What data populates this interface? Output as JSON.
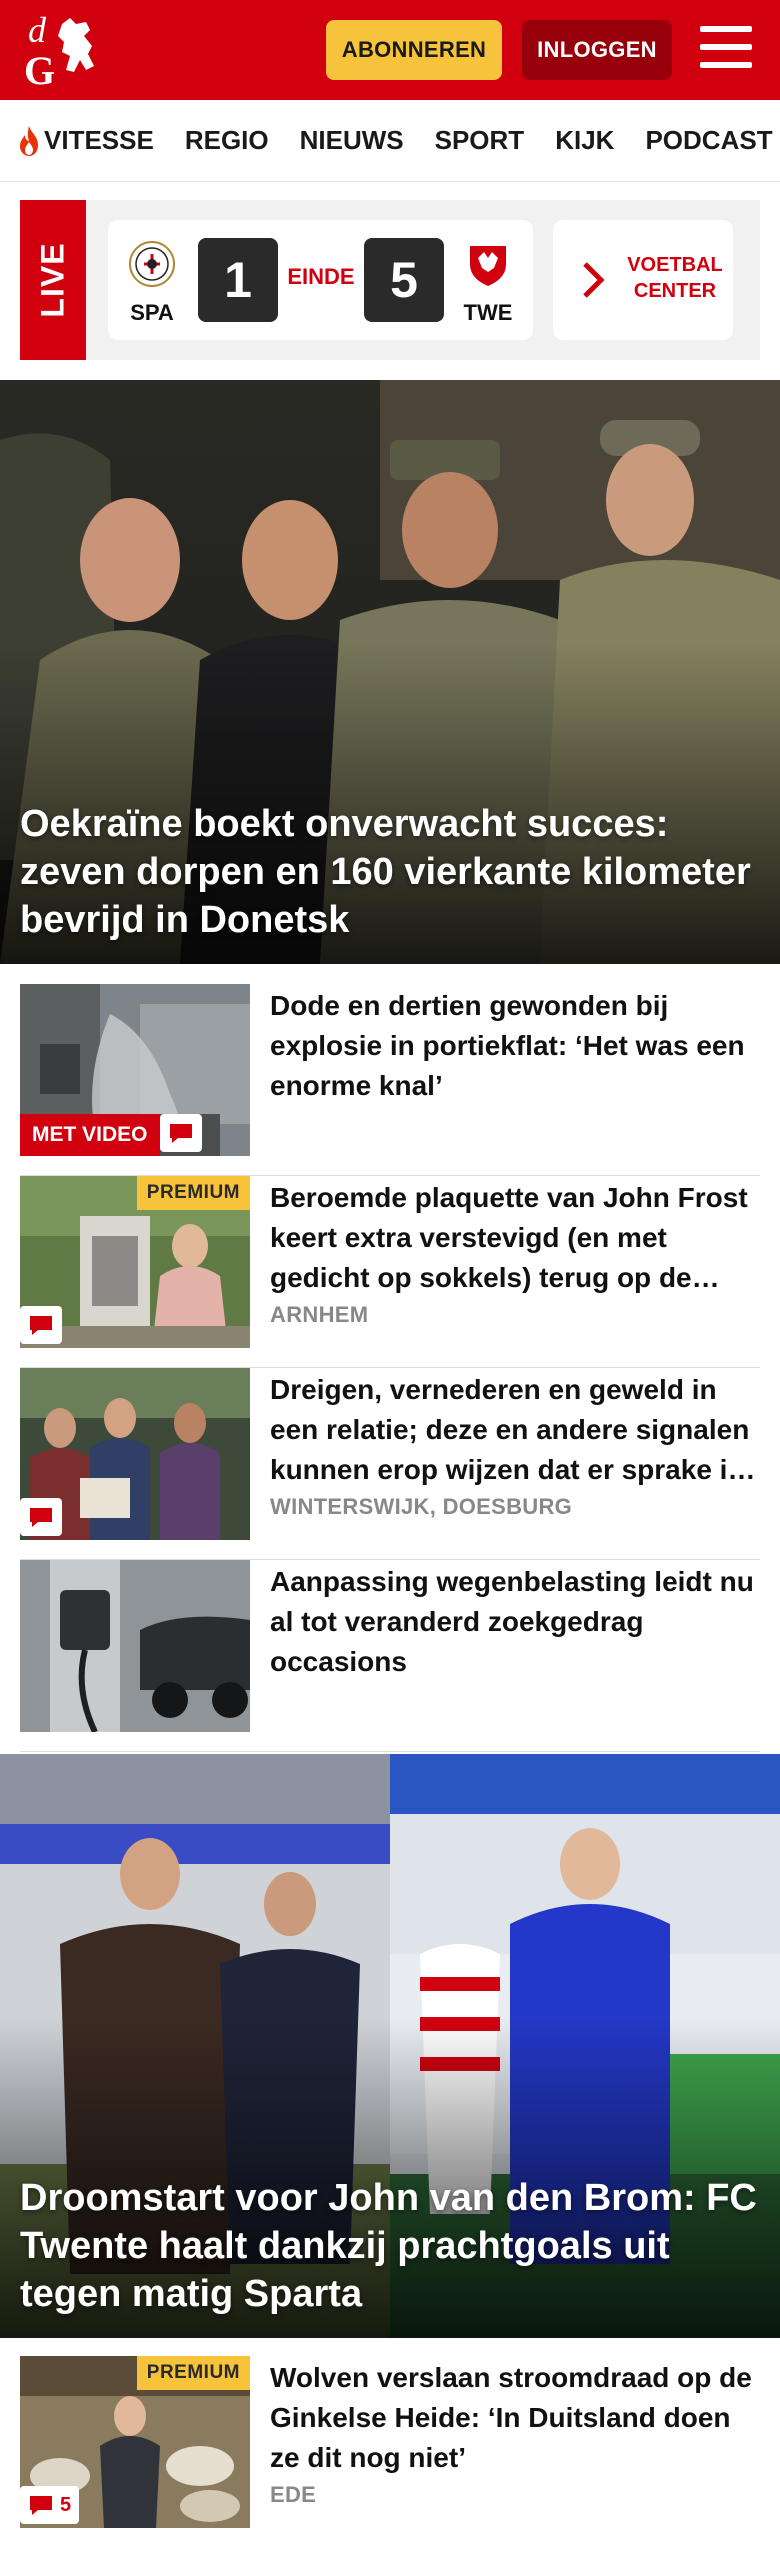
{
  "header": {
    "logo_text": "dG",
    "subscribe_label": "ABONNEREN",
    "login_label": "INLOGGEN",
    "colors": {
      "brand": "#d1000f",
      "subscribe": "#f7c33a",
      "login": "#97000b"
    }
  },
  "nav": {
    "items": [
      {
        "label": "VITESSE",
        "icon": "flame-icon"
      },
      {
        "label": "REGIO"
      },
      {
        "label": "NIEUWS"
      },
      {
        "label": "SPORT"
      },
      {
        "label": "KIJK"
      },
      {
        "label": "PODCAST"
      }
    ]
  },
  "live": {
    "label": "LIVE",
    "match": {
      "home": "SPA",
      "away": "TWE",
      "home_score": "1",
      "away_score": "5",
      "status": "EINDE"
    },
    "center_label_1": "VOETBAL",
    "center_label_2": "CENTER"
  },
  "hero": {
    "headline": "Oekraïne boekt onverwacht succes: zeven dorpen en 160 vierkante kilometer bevrijd in Donetsk"
  },
  "articles": [
    {
      "headline": "Dode en dertien gewonden bij explosie in portiekflat: ‘Het was een enorme knal’",
      "badge": "MET VIDEO",
      "has_comments": true
    },
    {
      "headline": "Beroemde plaquette van John Frost keert extra verstevigd (en met gedicht op sokkels) terug op de John Frostbrug",
      "premium": "PREMIUM",
      "location": "ARNHEM",
      "has_comments": true
    },
    {
      "headline": "Dreigen, vernederen en geweld in een relatie; deze en andere signalen kunnen erop wijzen dat er sprake is van huiselijk geweld",
      "location": "WINTERSWIJK, DOESBURG",
      "has_comments": true
    },
    {
      "headline": "Aanpassing wegenbelasting leidt nu al tot veranderd zoekgedrag occasions"
    }
  ],
  "hero2": {
    "headline": "Droomstart voor John van den Brom: FC Twente haalt dankzij prachtgoals uit tegen matig Sparta"
  },
  "article_bottom": {
    "headline": "Wolven verslaan stroomdraad op de Ginkelse Heide: ‘In Duitsland doen ze dit nog niet’",
    "premium": "PREMIUM",
    "location": "EDE",
    "comment_count": "5"
  }
}
